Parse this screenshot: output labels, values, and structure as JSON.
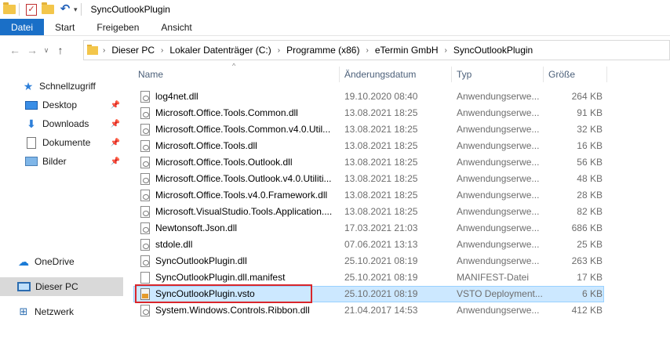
{
  "window": {
    "title": "SyncOutlookPlugin"
  },
  "ribbon": {
    "tabs": [
      {
        "label": "Datei",
        "active": true
      },
      {
        "label": "Start"
      },
      {
        "label": "Freigeben"
      },
      {
        "label": "Ansicht"
      }
    ]
  },
  "address": {
    "crumbs": [
      "Dieser PC",
      "Lokaler Datenträger (C:)",
      "Programme (x86)",
      "eTermin GmbH",
      "SyncOutlookPlugin"
    ]
  },
  "nav": {
    "items": [
      {
        "label": "Schnellzugriff",
        "icon": "star-icon"
      },
      {
        "label": "Desktop",
        "icon": "desktop-icon",
        "pinned": true
      },
      {
        "label": "Downloads",
        "icon": "download-icon",
        "pinned": true
      },
      {
        "label": "Dokumente",
        "icon": "documents-icon",
        "pinned": true
      },
      {
        "label": "Bilder",
        "icon": "pictures-icon",
        "pinned": true
      },
      {
        "label": "OneDrive",
        "icon": "cloud-icon"
      },
      {
        "label": "Dieser PC",
        "icon": "computer-icon",
        "selected": true
      },
      {
        "label": "Netzwerk",
        "icon": "network-icon"
      }
    ]
  },
  "columns": {
    "name": "Name",
    "date": "Änderungsdatum",
    "type": "Typ",
    "size": "Größe"
  },
  "files": [
    {
      "name": "log4net.dll",
      "date": "19.10.2020 08:40",
      "type": "Anwendungserwe...",
      "size": "264 KB",
      "icon": "dll"
    },
    {
      "name": "Microsoft.Office.Tools.Common.dll",
      "date": "13.08.2021 18:25",
      "type": "Anwendungserwe...",
      "size": "91 KB",
      "icon": "dll"
    },
    {
      "name": "Microsoft.Office.Tools.Common.v4.0.Util...",
      "date": "13.08.2021 18:25",
      "type": "Anwendungserwe...",
      "size": "32 KB",
      "icon": "dll"
    },
    {
      "name": "Microsoft.Office.Tools.dll",
      "date": "13.08.2021 18:25",
      "type": "Anwendungserwe...",
      "size": "16 KB",
      "icon": "dll"
    },
    {
      "name": "Microsoft.Office.Tools.Outlook.dll",
      "date": "13.08.2021 18:25",
      "type": "Anwendungserwe...",
      "size": "56 KB",
      "icon": "dll"
    },
    {
      "name": "Microsoft.Office.Tools.Outlook.v4.0.Utiliti...",
      "date": "13.08.2021 18:25",
      "type": "Anwendungserwe...",
      "size": "48 KB",
      "icon": "dll"
    },
    {
      "name": "Microsoft.Office.Tools.v4.0.Framework.dll",
      "date": "13.08.2021 18:25",
      "type": "Anwendungserwe...",
      "size": "28 KB",
      "icon": "dll"
    },
    {
      "name": "Microsoft.VisualStudio.Tools.Application....",
      "date": "13.08.2021 18:25",
      "type": "Anwendungserwe...",
      "size": "82 KB",
      "icon": "dll"
    },
    {
      "name": "Newtonsoft.Json.dll",
      "date": "17.03.2021 21:03",
      "type": "Anwendungserwe...",
      "size": "686 KB",
      "icon": "dll"
    },
    {
      "name": "stdole.dll",
      "date": "07.06.2021 13:13",
      "type": "Anwendungserwe...",
      "size": "25 KB",
      "icon": "dll"
    },
    {
      "name": "SyncOutlookPlugin.dll",
      "date": "25.10.2021 08:19",
      "type": "Anwendungserwe...",
      "size": "263 KB",
      "icon": "dll"
    },
    {
      "name": "SyncOutlookPlugin.dll.manifest",
      "date": "25.10.2021 08:19",
      "type": "MANIFEST-Datei",
      "size": "17 KB",
      "icon": "file"
    },
    {
      "name": "SyncOutlookPlugin.vsto",
      "date": "25.10.2021 08:19",
      "type": "VSTO Deployment...",
      "size": "6 KB",
      "icon": "vsto",
      "selected": true
    },
    {
      "name": "System.Windows.Controls.Ribbon.dll",
      "date": "21.04.2017 14:53",
      "type": "Anwendungserwe...",
      "size": "412 KB",
      "icon": "dll"
    }
  ]
}
